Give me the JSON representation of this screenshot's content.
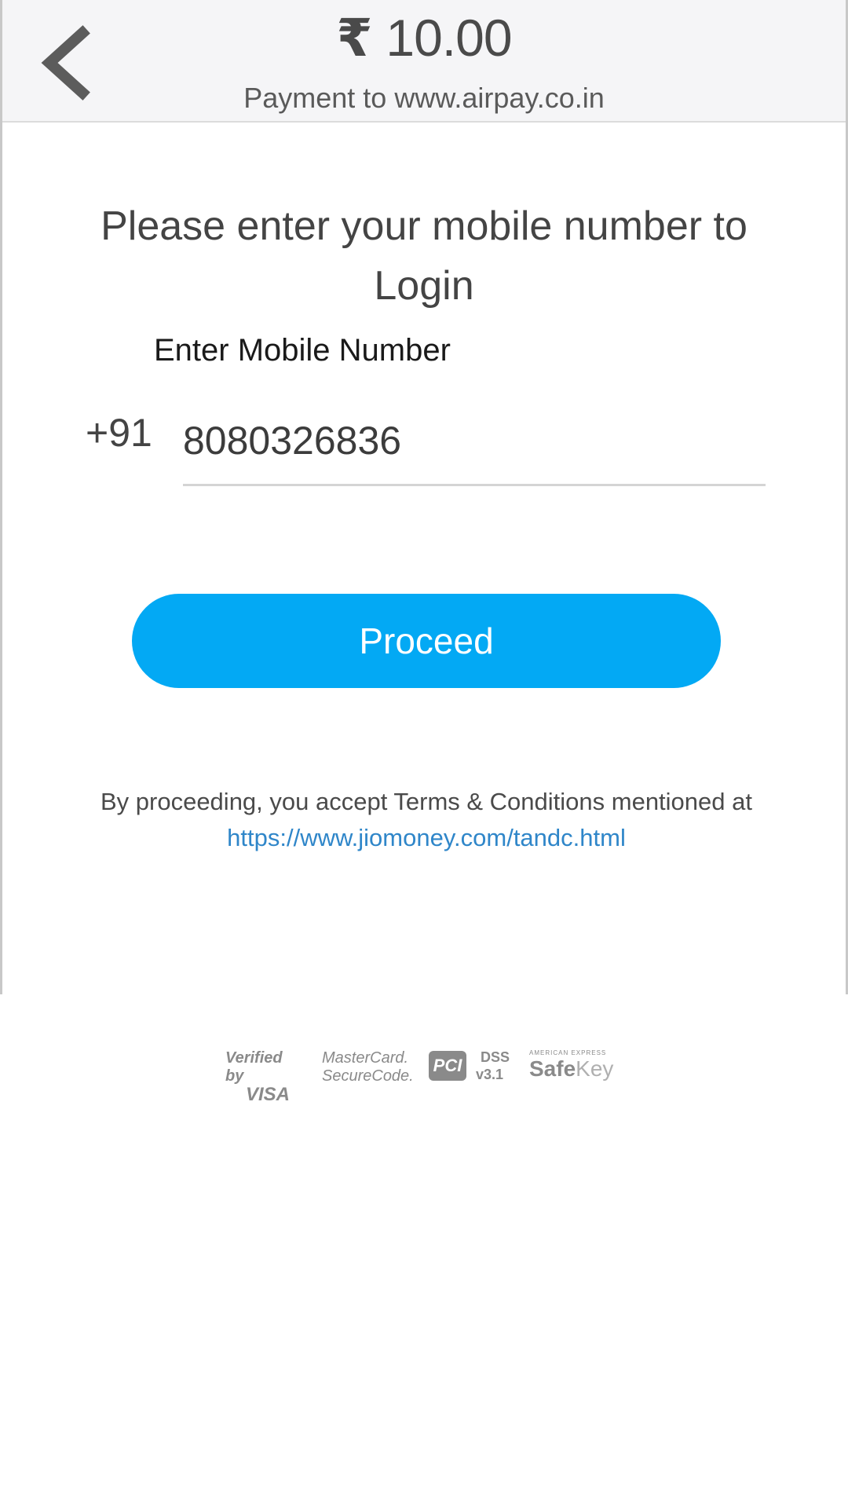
{
  "header": {
    "currency_symbol": "₹",
    "amount": "10.00",
    "payment_to": "Payment to www.airpay.co.in",
    "back_icon": "chevron-left-icon"
  },
  "login": {
    "prompt": "Please enter your mobile number to Login",
    "mobile_label": "Enter Mobile Number",
    "country_code": "+91",
    "mobile_value": "8080326836"
  },
  "actions": {
    "proceed_label": "Proceed",
    "accent_color": "#03a9f4"
  },
  "terms": {
    "text": "By proceeding, you accept Terms & Conditions mentioned at ",
    "link": "https://www.jiomoney.com/tandc.html"
  },
  "badges": {
    "visa_line1": "Verified by",
    "visa_line2": "VISA",
    "mc_line1": "MasterCard.",
    "mc_line2": "SecureCode.",
    "pci_logo": "PCI",
    "pci_dss": "DSS",
    "pci_version": "v3.1",
    "amex_small": "AMERICAN EXPRESS",
    "safekey_bold": "Safe",
    "safekey_thin": "Key"
  }
}
